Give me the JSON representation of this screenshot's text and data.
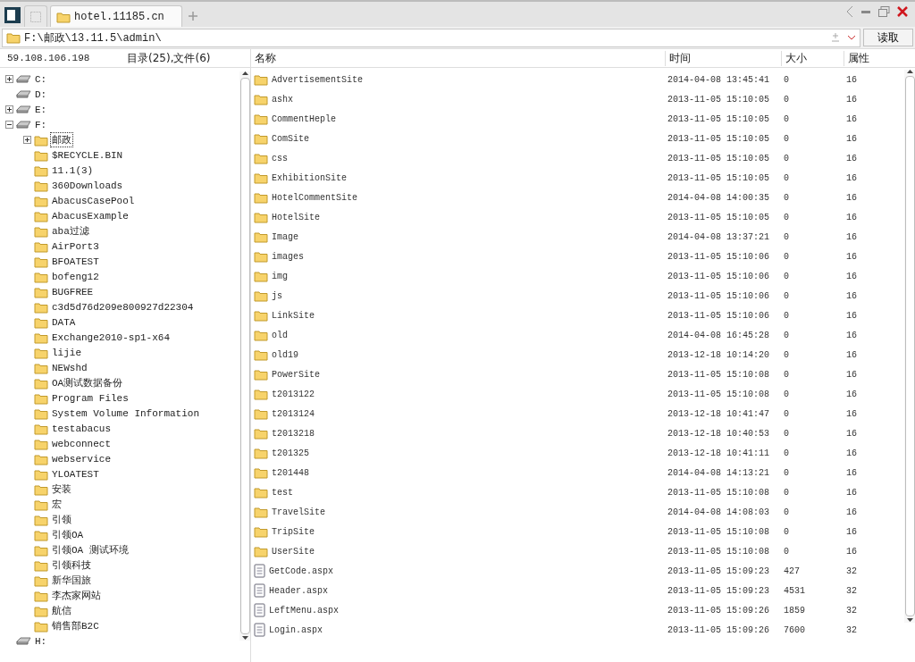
{
  "tabs": [
    {
      "label": "hotel.11185.cn",
      "selected": true
    }
  ],
  "address": {
    "value": "F:\\邮政\\13.11.5\\admin\\",
    "button": "读取"
  },
  "info": {
    "host": "59.108.106.198",
    "counts": "目录(25),文件(6)"
  },
  "tree": [
    {
      "label": "C:",
      "kind": "drive",
      "expanded": false
    },
    {
      "label": "D:",
      "kind": "drive"
    },
    {
      "label": "E:",
      "kind": "drive",
      "expanded": false
    },
    {
      "label": "F:",
      "kind": "drive",
      "expanded": true,
      "children": [
        {
          "label": "邮政",
          "kind": "folder",
          "expanded": false,
          "selected": true
        },
        {
          "label": "$RECYCLE.BIN",
          "kind": "folder"
        },
        {
          "label": "11.1(3)",
          "kind": "folder"
        },
        {
          "label": "360Downloads",
          "kind": "folder"
        },
        {
          "label": "AbacusCasePool",
          "kind": "folder"
        },
        {
          "label": "AbacusExample",
          "kind": "folder"
        },
        {
          "label": "aba过滤",
          "kind": "folder"
        },
        {
          "label": "AirPort3",
          "kind": "folder"
        },
        {
          "label": "BFOATEST",
          "kind": "folder"
        },
        {
          "label": "bofeng12",
          "kind": "folder"
        },
        {
          "label": "BUGFREE",
          "kind": "folder"
        },
        {
          "label": "c3d5d76d209e800927d22304",
          "kind": "folder"
        },
        {
          "label": "DATA",
          "kind": "folder"
        },
        {
          "label": "Exchange2010-sp1-x64",
          "kind": "folder"
        },
        {
          "label": "lijie",
          "kind": "folder"
        },
        {
          "label": "NEWshd",
          "kind": "folder"
        },
        {
          "label": "OA测试数据备份",
          "kind": "folder"
        },
        {
          "label": "Program Files",
          "kind": "folder"
        },
        {
          "label": "System Volume Information",
          "kind": "folder"
        },
        {
          "label": "testabacus",
          "kind": "folder"
        },
        {
          "label": "webconnect",
          "kind": "folder"
        },
        {
          "label": "webservice",
          "kind": "folder"
        },
        {
          "label": "YLOATEST",
          "kind": "folder"
        },
        {
          "label": "安装",
          "kind": "folder"
        },
        {
          "label": "宏",
          "kind": "folder"
        },
        {
          "label": "引领",
          "kind": "folder"
        },
        {
          "label": "引领OA",
          "kind": "folder"
        },
        {
          "label": "引领OA 测试环境",
          "kind": "folder"
        },
        {
          "label": "引领科技",
          "kind": "folder"
        },
        {
          "label": "新华国旅",
          "kind": "folder"
        },
        {
          "label": "李杰家网站",
          "kind": "folder"
        },
        {
          "label": "航信",
          "kind": "folder"
        },
        {
          "label": "销售部B2C",
          "kind": "folder"
        }
      ]
    },
    {
      "label": "H:",
      "kind": "drive"
    }
  ],
  "table": {
    "columns": [
      "名称",
      "时间",
      "大小",
      "属性"
    ],
    "rows": [
      {
        "kind": "folder",
        "name": "AdvertisementSite",
        "time": "2014-04-08 13:45:41",
        "size": "0",
        "attr": "16"
      },
      {
        "kind": "folder",
        "name": "ashx",
        "time": "2013-11-05 15:10:05",
        "size": "0",
        "attr": "16"
      },
      {
        "kind": "folder",
        "name": "CommentHeple",
        "time": "2013-11-05 15:10:05",
        "size": "0",
        "attr": "16"
      },
      {
        "kind": "folder",
        "name": "ComSite",
        "time": "2013-11-05 15:10:05",
        "size": "0",
        "attr": "16"
      },
      {
        "kind": "folder",
        "name": "css",
        "time": "2013-11-05 15:10:05",
        "size": "0",
        "attr": "16"
      },
      {
        "kind": "folder",
        "name": "ExhibitionSite",
        "time": "2013-11-05 15:10:05",
        "size": "0",
        "attr": "16"
      },
      {
        "kind": "folder",
        "name": "HotelCommentSite",
        "time": "2014-04-08 14:00:35",
        "size": "0",
        "attr": "16"
      },
      {
        "kind": "folder",
        "name": "HotelSite",
        "time": "2013-11-05 15:10:05",
        "size": "0",
        "attr": "16"
      },
      {
        "kind": "folder",
        "name": "Image",
        "time": "2014-04-08 13:37:21",
        "size": "0",
        "attr": "16"
      },
      {
        "kind": "folder",
        "name": "images",
        "time": "2013-11-05 15:10:06",
        "size": "0",
        "attr": "16"
      },
      {
        "kind": "folder",
        "name": "img",
        "time": "2013-11-05 15:10:06",
        "size": "0",
        "attr": "16"
      },
      {
        "kind": "folder",
        "name": "js",
        "time": "2013-11-05 15:10:06",
        "size": "0",
        "attr": "16"
      },
      {
        "kind": "folder",
        "name": "LinkSite",
        "time": "2013-11-05 15:10:06",
        "size": "0",
        "attr": "16"
      },
      {
        "kind": "folder",
        "name": "old",
        "time": "2014-04-08 16:45:28",
        "size": "0",
        "attr": "16"
      },
      {
        "kind": "folder",
        "name": "old19",
        "time": "2013-12-18 10:14:20",
        "size": "0",
        "attr": "16"
      },
      {
        "kind": "folder",
        "name": "PowerSite",
        "time": "2013-11-05 15:10:08",
        "size": "0",
        "attr": "16"
      },
      {
        "kind": "folder",
        "name": "t2013122",
        "time": "2013-11-05 15:10:08",
        "size": "0",
        "attr": "16"
      },
      {
        "kind": "folder",
        "name": "t2013124",
        "time": "2013-12-18 10:41:47",
        "size": "0",
        "attr": "16"
      },
      {
        "kind": "folder",
        "name": "t2013218",
        "time": "2013-12-18 10:40:53",
        "size": "0",
        "attr": "16"
      },
      {
        "kind": "folder",
        "name": "t201325",
        "time": "2013-12-18 10:41:11",
        "size": "0",
        "attr": "16"
      },
      {
        "kind": "folder",
        "name": "t201448",
        "time": "2014-04-08 14:13:21",
        "size": "0",
        "attr": "16"
      },
      {
        "kind": "folder",
        "name": "test",
        "time": "2013-11-05 15:10:08",
        "size": "0",
        "attr": "16"
      },
      {
        "kind": "folder",
        "name": "TravelSite",
        "time": "2014-04-08 14:08:03",
        "size": "0",
        "attr": "16"
      },
      {
        "kind": "folder",
        "name": "TripSite",
        "time": "2013-11-05 15:10:08",
        "size": "0",
        "attr": "16"
      },
      {
        "kind": "folder",
        "name": "UserSite",
        "time": "2013-11-05 15:10:08",
        "size": "0",
        "attr": "16"
      },
      {
        "kind": "file",
        "name": "GetCode.aspx",
        "time": "2013-11-05 15:09:23",
        "size": "427",
        "attr": "32"
      },
      {
        "kind": "file",
        "name": "Header.aspx",
        "time": "2013-11-05 15:09:23",
        "size": "4531",
        "attr": "32"
      },
      {
        "kind": "file",
        "name": "LeftMenu.aspx",
        "time": "2013-11-05 15:09:26",
        "size": "1859",
        "attr": "32"
      },
      {
        "kind": "file",
        "name": "Login.aspx",
        "time": "2013-11-05 15:09:26",
        "size": "7600",
        "attr": "32"
      }
    ]
  }
}
